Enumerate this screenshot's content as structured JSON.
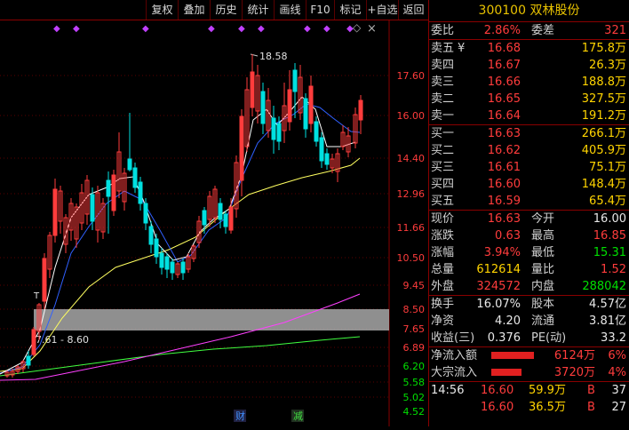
{
  "toolbar": {
    "buttons": [
      "复权",
      "叠加",
      "历史",
      "统计",
      "画线",
      "F10",
      "标记",
      "+自选",
      "返回"
    ]
  },
  "chart": {
    "price_axis": [
      "17.60",
      "16.00",
      "14.40",
      "12.96",
      "11.66",
      "10.50",
      "9.45",
      "8.50",
      "7.65",
      "6.89",
      "6.20",
      "5.58",
      "5.02",
      "4.52"
    ],
    "peak_label": "18.58",
    "zone_label": "7.61 - 8.60",
    "marker_t": "T",
    "event_fin": "财",
    "event_reduce": "减",
    "diamond": "◇",
    "close_x": "×",
    "colors": {
      "up": "#ff3c3c",
      "down": "#00e0e0",
      "ma5": "#ffffff",
      "ma10": "#3060ff",
      "ma20": "#ffff60",
      "ma60": "#ff40ff",
      "ma120": "#40ff40"
    }
  },
  "quote": {
    "title": "300100 双林股份",
    "weibi": {
      "label": "委比",
      "value": "2.86%",
      "label2": "委差",
      "value2": "321"
    },
    "asks": [
      {
        "label": "卖五",
        "price": "16.68",
        "vol": "175.8万"
      },
      {
        "label": "卖四",
        "price": "16.67",
        "vol": "26.3万"
      },
      {
        "label": "卖三",
        "price": "16.66",
        "vol": "188.8万"
      },
      {
        "label": "卖二",
        "price": "16.65",
        "vol": "327.5万"
      },
      {
        "label": "卖一",
        "price": "16.64",
        "vol": "191.2万"
      }
    ],
    "ask_marker": "¥",
    "bids": [
      {
        "label": "买一",
        "price": "16.63",
        "vol": "266.1万"
      },
      {
        "label": "买二",
        "price": "16.62",
        "vol": "405.9万"
      },
      {
        "label": "买三",
        "price": "16.61",
        "vol": "75.1万"
      },
      {
        "label": "买四",
        "price": "16.60",
        "vol": "148.4万"
      },
      {
        "label": "买五",
        "price": "16.59",
        "vol": "65.4万"
      }
    ],
    "stats1": [
      {
        "l1": "现价",
        "v1": "16.63",
        "l2": "今开",
        "v2": "16.00"
      },
      {
        "l1": "涨跌",
        "v1": "0.63",
        "l2": "最高",
        "v2": "16.85"
      },
      {
        "l1": "涨幅",
        "v1": "3.94%",
        "l2": "最低",
        "v2": "15.31"
      },
      {
        "l1": "总量",
        "v1": "612614",
        "l2": "量比",
        "v2": "1.52"
      },
      {
        "l1": "外盘",
        "v1": "324572",
        "l2": "内盘",
        "v2": "288042"
      }
    ],
    "stats2": [
      {
        "l1": "换手",
        "v1": "16.07%",
        "l2": "股本",
        "v2": "4.57亿"
      },
      {
        "l1": "净资",
        "v1": "4.20",
        "l2": "流通",
        "v2": "3.81亿"
      },
      {
        "l1": "收益(三)",
        "v1": "0.376",
        "l2": "PE(动)",
        "v2": "33.2"
      }
    ],
    "flows": [
      {
        "label": "净流入额",
        "value": "6124万",
        "pct": "6%",
        "level": 0.85
      },
      {
        "label": "大宗流入",
        "value": "3720万",
        "pct": "4%",
        "level": 0.6
      }
    ],
    "ticks": [
      {
        "time": "14:56",
        "price": "16.60",
        "vol": "59.9万",
        "side": "B",
        "count": "37"
      },
      {
        "time": "",
        "price": "16.60",
        "vol": "36.5万",
        "side": "B",
        "count": "27"
      }
    ]
  }
}
